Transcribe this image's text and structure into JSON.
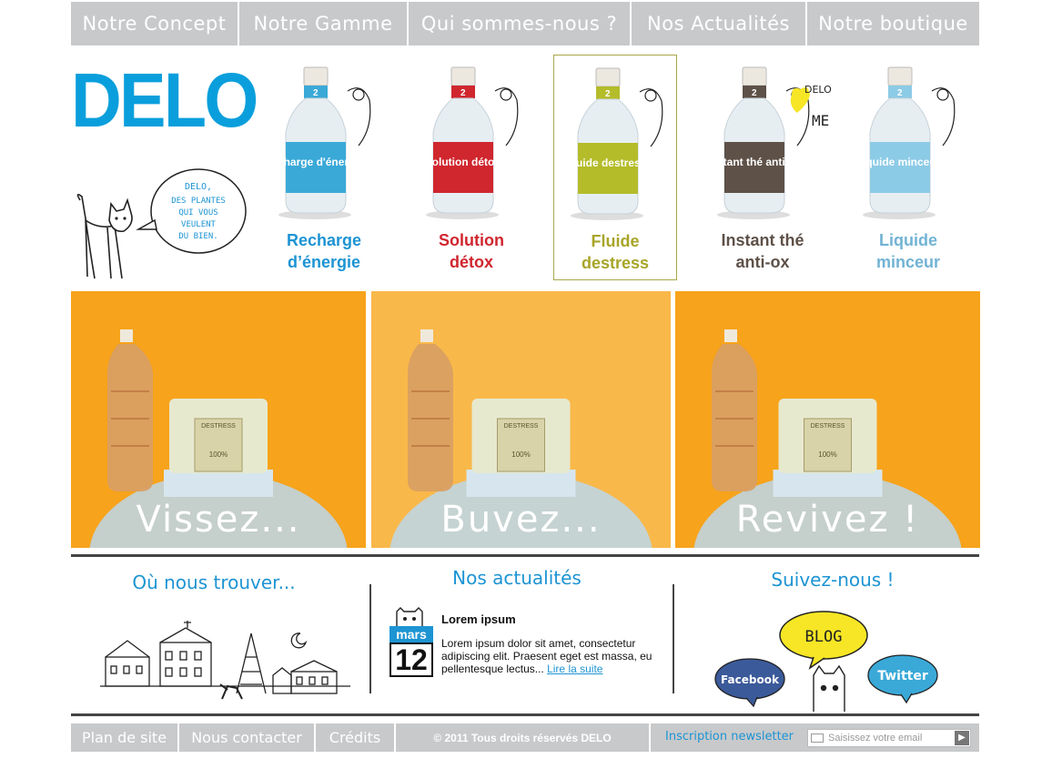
{
  "nav": {
    "tabs": [
      {
        "label": "Notre Concept"
      },
      {
        "label": "Notre Gamme"
      },
      {
        "label": "Qui sommes-nous ?"
      },
      {
        "label": "Nos Actualités"
      },
      {
        "label": "Notre boutique"
      }
    ]
  },
  "brand": {
    "logo": "DELO",
    "tagline": [
      "DELO,",
      "DES PLANTES",
      "QUI VOUS",
      "VEULENT",
      "DU BIEN."
    ]
  },
  "products": [
    {
      "line1": "Recharge",
      "line2": "d’énergie",
      "label_text": "recharge d'énergie",
      "color": "#1d94d3",
      "bottle_color": "#3aa9d8",
      "active": false
    },
    {
      "line1": "Solution",
      "line2": "détox",
      "label_text": "solution détox",
      "color": "#d0262e",
      "bottle_color": "#d0262e",
      "active": false
    },
    {
      "line1": "Fluide",
      "line2": "destress",
      "label_text": "fluide destress",
      "color": "#a8a528",
      "bottle_color": "#b4bc2a",
      "active": true
    },
    {
      "line1": "Instant thé",
      "line2": "anti-ox",
      "label_text": "instant thé anti-ox",
      "color": "#5e5148",
      "bottle_color": "#5e5148",
      "active": false
    },
    {
      "line1": "Liquide",
      "line2": "minceur",
      "label_text": "liquide minceur",
      "color": "#71b3d4",
      "bottle_color": "#8ccbe6",
      "active": false
    }
  ],
  "doodle_text": {
    "delo": "DELO",
    "me": "ME"
  },
  "banners": [
    {
      "caption": "Vissez...",
      "bg": "#f7a31b"
    },
    {
      "caption": "Buvez...",
      "bg": "#f9b84a"
    },
    {
      "caption": "Revivez !",
      "bg": "#f7a31b"
    }
  ],
  "bottle_badge": {
    "line1": "DESTRESS",
    "line2": "100%"
  },
  "sections": {
    "find": {
      "title": "Où nous trouver..."
    },
    "news": {
      "title": "Nos actualités",
      "date_month": "mars",
      "date_day": "12",
      "item_title": "Lorem ipsum",
      "item_body": "Lorem ipsum dolor sit amet, consectetur adipiscing elit. Praesent eget est massa, eu pellentesque lectus...",
      "read_more": "Lire la suite"
    },
    "follow": {
      "title": "Suivez-nous !",
      "blog": "BLOG",
      "facebook": "Facebook",
      "twitter": "Twitter"
    }
  },
  "footer": {
    "sitemap": "Plan de site",
    "contact": "Nous contacter",
    "credits": "Crédits",
    "copyright": "© 2011 Tous droits réservés DELO",
    "newsletter_label": "Inscription newsletter",
    "email_placeholder": "Saisissez votre email"
  }
}
